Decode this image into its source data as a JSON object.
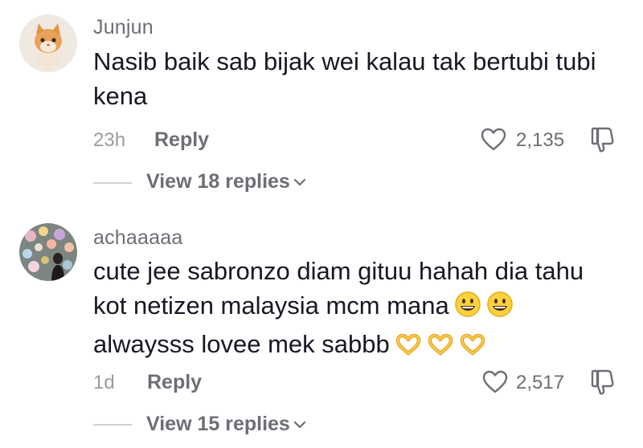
{
  "comments": [
    {
      "username": "Junjun",
      "text_lines": [
        "Nasib baik sab bijak wei kalau tak bertubi tubi",
        "kena"
      ],
      "time": "23h",
      "reply_label": "Reply",
      "likes": "2,135",
      "view_replies": "View 18 replies",
      "avatar": "cat-avatar"
    },
    {
      "username": "achaaaaa",
      "text_lines": [
        "cute jee sabronzo diam gituu hahah dia tahu",
        "kot netizen malaysia mcm mana",
        "alwaysss lovee mek sabbb"
      ],
      "emoji_line2": [
        "grinning-face-emoji",
        "grinning-face-emoji"
      ],
      "emoji_line3": [
        "heart-hands-emoji",
        "heart-hands-emoji",
        "heart-hands-emoji"
      ],
      "time": "1d",
      "reply_label": "Reply",
      "likes": "2,517",
      "view_replies": "View 15 replies",
      "avatar": "floral-avatar"
    }
  ],
  "colors": {
    "primary_text": "#161823",
    "secondary_text": "#6d6e75",
    "tertiary_text": "#9a9ba1",
    "divider": "#d0d1d3"
  }
}
